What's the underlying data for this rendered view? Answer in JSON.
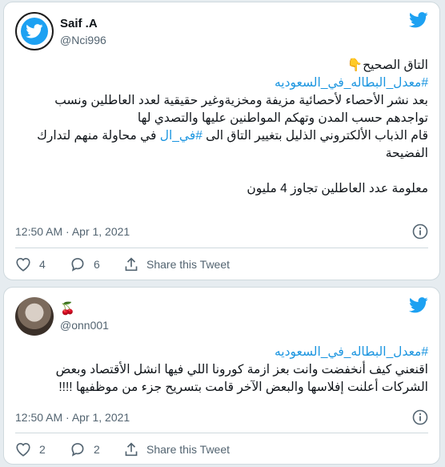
{
  "tweets": [
    {
      "display_name": "Saif .A",
      "handle": "@Nci996",
      "line1": "التاق الصحيح👇",
      "hashtag": "#معدل_البطاله_في_السعوديه",
      "para_a": "بعد نشر الأحصاء لأحصائية مزيفة ومخزيةوغير حقيقية لعدد العاطلين ونسب تواجدهم حسب المدن وتهكم المواطنين عليها والتصدي لها",
      "para_b_pre": "قام الذباب الألكتروني الذليل بتغيير التاق الى ",
      "para_b_link": "#في_ال",
      "para_b_post": " في محاولة منهم لتدارك الفضيحة",
      "para_c": "معلومة عدد العاطلين تجاوز 4 مليون",
      "timestamp": "12:50 AM · Apr 1, 2021",
      "likes": "4",
      "replies": "6",
      "share_label": "Share this Tweet"
    },
    {
      "display_name": "🍒",
      "handle": "@onn001",
      "hashtag": "#معدل_البطاله_في_السعوديه",
      "para_a": "اقنعني كيف أنخفضت وانت بعز ازمة كورونا اللي فيها انشل الأقتصاد وبعض الشركات أعلنت إفلاسها والبعض الآخر قامت بتسريح جزء من موظفيها !!!!",
      "timestamp": "12:50 AM · Apr 1, 2021",
      "likes": "2",
      "replies": "2",
      "share_label": "Share this Tweet"
    }
  ],
  "colors": {
    "accent": "#1da1f2",
    "link": "#1b95e0",
    "muted": "#536471"
  }
}
